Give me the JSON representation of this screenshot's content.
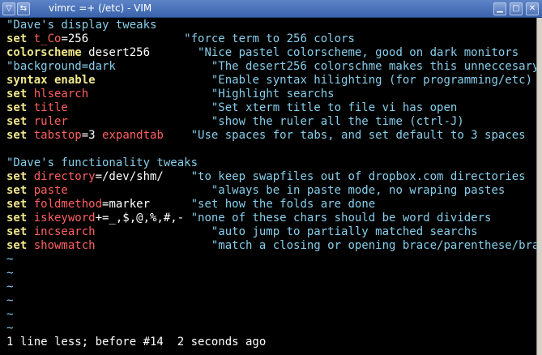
{
  "window": {
    "title": "vimrc =+ (/etc) - VIM",
    "menu_glyph": "▽",
    "back_glyph": "⇆",
    "minimize_glyph": "▁",
    "maximize_glyph": "□",
    "close_glyph": "✕"
  },
  "lines": [
    [
      {
        "c": "cm",
        "t": "\"Dave's display tweaks"
      }
    ],
    [
      {
        "c": "kw",
        "t": "set "
      },
      {
        "c": "opt",
        "t": "t_Co"
      },
      {
        "c": "val",
        "t": "=256"
      },
      {
        "c": "cm",
        "t": "              \"force term to 256 colors"
      }
    ],
    [
      {
        "c": "kw",
        "t": "colorscheme"
      },
      {
        "c": "val",
        "t": " desert256"
      },
      {
        "c": "cm",
        "t": "       \"Nice pastel colorscheme, good on dark monitors"
      }
    ],
    [
      {
        "c": "cm",
        "t": "\"background=dark              \"The desert256 colorschme makes this unneccesary"
      }
    ],
    [
      {
        "c": "kw",
        "t": "syntax enable"
      },
      {
        "c": "cm",
        "t": "                 \"Enable syntax hilighting (for programming/etc)"
      }
    ],
    [
      {
        "c": "kw",
        "t": "set "
      },
      {
        "c": "opt",
        "t": "hlsearch"
      },
      {
        "c": "cm",
        "t": "                  \"Highlight searchs"
      }
    ],
    [
      {
        "c": "kw",
        "t": "set "
      },
      {
        "c": "opt",
        "t": "title"
      },
      {
        "c": "cm",
        "t": "                     \"Set xterm title to file vi has open"
      }
    ],
    [
      {
        "c": "kw",
        "t": "set "
      },
      {
        "c": "opt",
        "t": "ruler"
      },
      {
        "c": "cm",
        "t": "                     \"show the ruler all the time (ctrl-J)"
      }
    ],
    [
      {
        "c": "kw",
        "t": "set "
      },
      {
        "c": "opt",
        "t": "tabstop"
      },
      {
        "c": "val",
        "t": "=3 "
      },
      {
        "c": "opt",
        "t": "expandtab"
      },
      {
        "c": "cm",
        "t": "    \"Use spaces for tabs, and set default to 3 spaces"
      }
    ],
    [],
    [
      {
        "c": "cm",
        "t": "\"Dave's functionality tweaks"
      }
    ],
    [
      {
        "c": "kw",
        "t": "set "
      },
      {
        "c": "opt",
        "t": "directory"
      },
      {
        "c": "val",
        "t": "=/dev/shm/"
      },
      {
        "c": "cm",
        "t": "    \"to keep swapfiles out of dropbox.com directories"
      }
    ],
    [
      {
        "c": "kw",
        "t": "set "
      },
      {
        "c": "opt",
        "t": "paste"
      },
      {
        "c": "cm",
        "t": "                     \"always be in paste mode, no wraping pastes"
      }
    ],
    [
      {
        "c": "kw",
        "t": "set "
      },
      {
        "c": "opt",
        "t": "foldmethod"
      },
      {
        "c": "val",
        "t": "=marker"
      },
      {
        "c": "cm",
        "t": "      \"set how the folds are done"
      }
    ],
    [
      {
        "c": "kw",
        "t": "set "
      },
      {
        "c": "opt",
        "t": "iskeyword"
      },
      {
        "c": "val",
        "t": "+=_,$,@,%,#,-"
      },
      {
        "c": "cm",
        "t": " \"none of these chars should be word dividers"
      }
    ],
    [
      {
        "c": "kw",
        "t": "set "
      },
      {
        "c": "opt",
        "t": "incsearch"
      },
      {
        "c": "cm",
        "t": "                 \"auto jump to partially matched searchs"
      }
    ],
    [
      {
        "c": "kw",
        "t": "set "
      },
      {
        "c": "opt",
        "t": "showmatch"
      },
      {
        "c": "cm",
        "t": "                 \"match a closing or opening brace/parenthese/bracket"
      }
    ],
    [
      {
        "c": "tilde",
        "t": "~"
      }
    ],
    [
      {
        "c": "tilde",
        "t": "~"
      }
    ],
    [
      {
        "c": "tilde",
        "t": "~"
      }
    ],
    [
      {
        "c": "tilde",
        "t": "~"
      }
    ],
    [
      {
        "c": "tilde",
        "t": "~"
      }
    ],
    [
      {
        "c": "tilde",
        "t": "~"
      }
    ]
  ],
  "status": "1 line less; before #14  2 seconds ago"
}
